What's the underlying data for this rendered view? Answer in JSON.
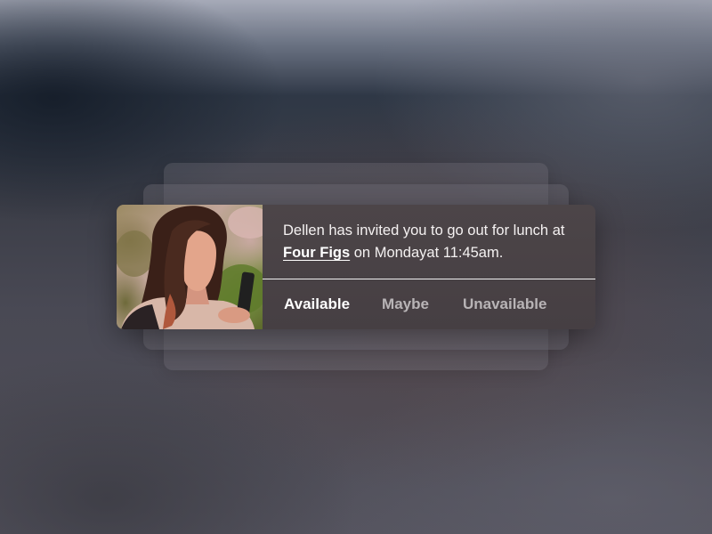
{
  "notification": {
    "message_before": "Dellen has invited you to go out for lunch at ",
    "venue": "Four Figs",
    "message_after": " on Mondayat 11:45am.",
    "photo_icon": "profile-photo"
  },
  "actions": {
    "available": "Available",
    "maybe": "Maybe",
    "unavailable": "Unavailable"
  },
  "colors": {
    "card_background": "#4a4346",
    "active_action": "#ffffff",
    "inactive_action": "#b8b4b6"
  }
}
